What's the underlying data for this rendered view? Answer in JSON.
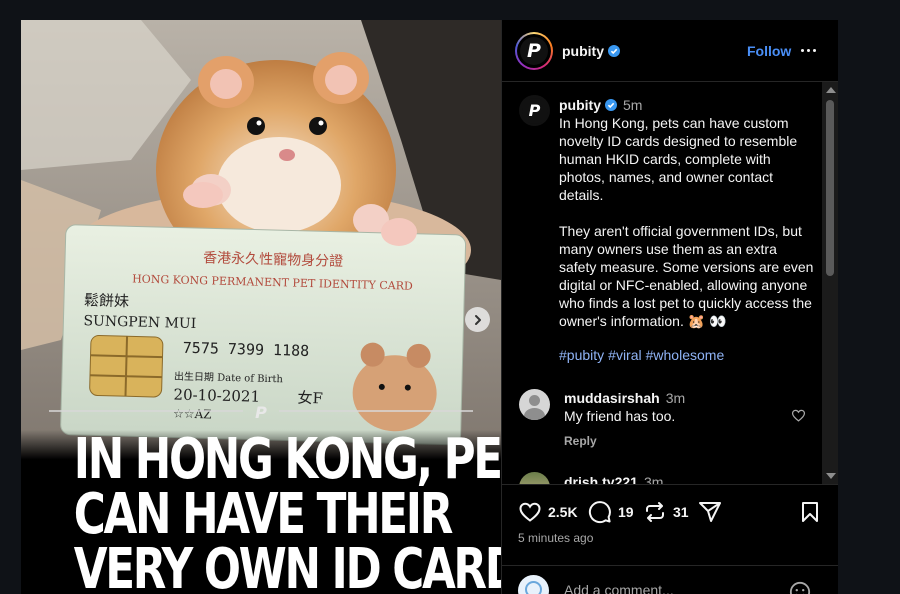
{
  "post": {
    "username": "pubity",
    "follow_label": "Follow",
    "headline_lines": [
      "IN HONG KONG, PETS",
      "CAN HAVE THEIR",
      "VERY OWN ID CARD"
    ],
    "card_text": {
      "chinese_title": "香港永久性寵物身分證",
      "english_title": "HONG KONG PERMANENT PET IDENTITY CARD",
      "chinese_name": "鬆餅妹",
      "name": "SUNGPEN MUI",
      "id_number": "7575 7399 1188",
      "dob_label": "出生日期 Date of Birth",
      "dob": "20-10-2021",
      "sex": "女F",
      "code": "☆☆AZ"
    }
  },
  "caption": {
    "username": "pubity",
    "time": "5m",
    "text": "In Hong Kong, pets can have custom novelty ID cards designed to resemble human HKID cards, complete with photos, names, and owner contact details.\n\nThey aren't official government IDs, but many owners use them as an extra safety measure. Some versions are even digital or NFC-enabled, allowing anyone who finds a lost pet to quickly access the owner's information. 🐹 👀",
    "hashtags": [
      "#pubity",
      "#viral",
      "#wholesome"
    ]
  },
  "comments": [
    {
      "username": "muddasirshah",
      "time": "3m",
      "text": "My friend has too.",
      "reply_label": "Reply"
    },
    {
      "username": "drish.ty221",
      "time": "3m",
      "text": ""
    }
  ],
  "stats": {
    "likes": "2.5K",
    "comments": "19",
    "reposts": "31"
  },
  "posted_ago": "5 minutes ago",
  "add_comment": {
    "placeholder": "Add a comment..."
  },
  "colors": {
    "accent": "#4a8ff7",
    "hashtag": "#8fb3f5",
    "muted": "#a8a8a8",
    "background": "#000000"
  }
}
